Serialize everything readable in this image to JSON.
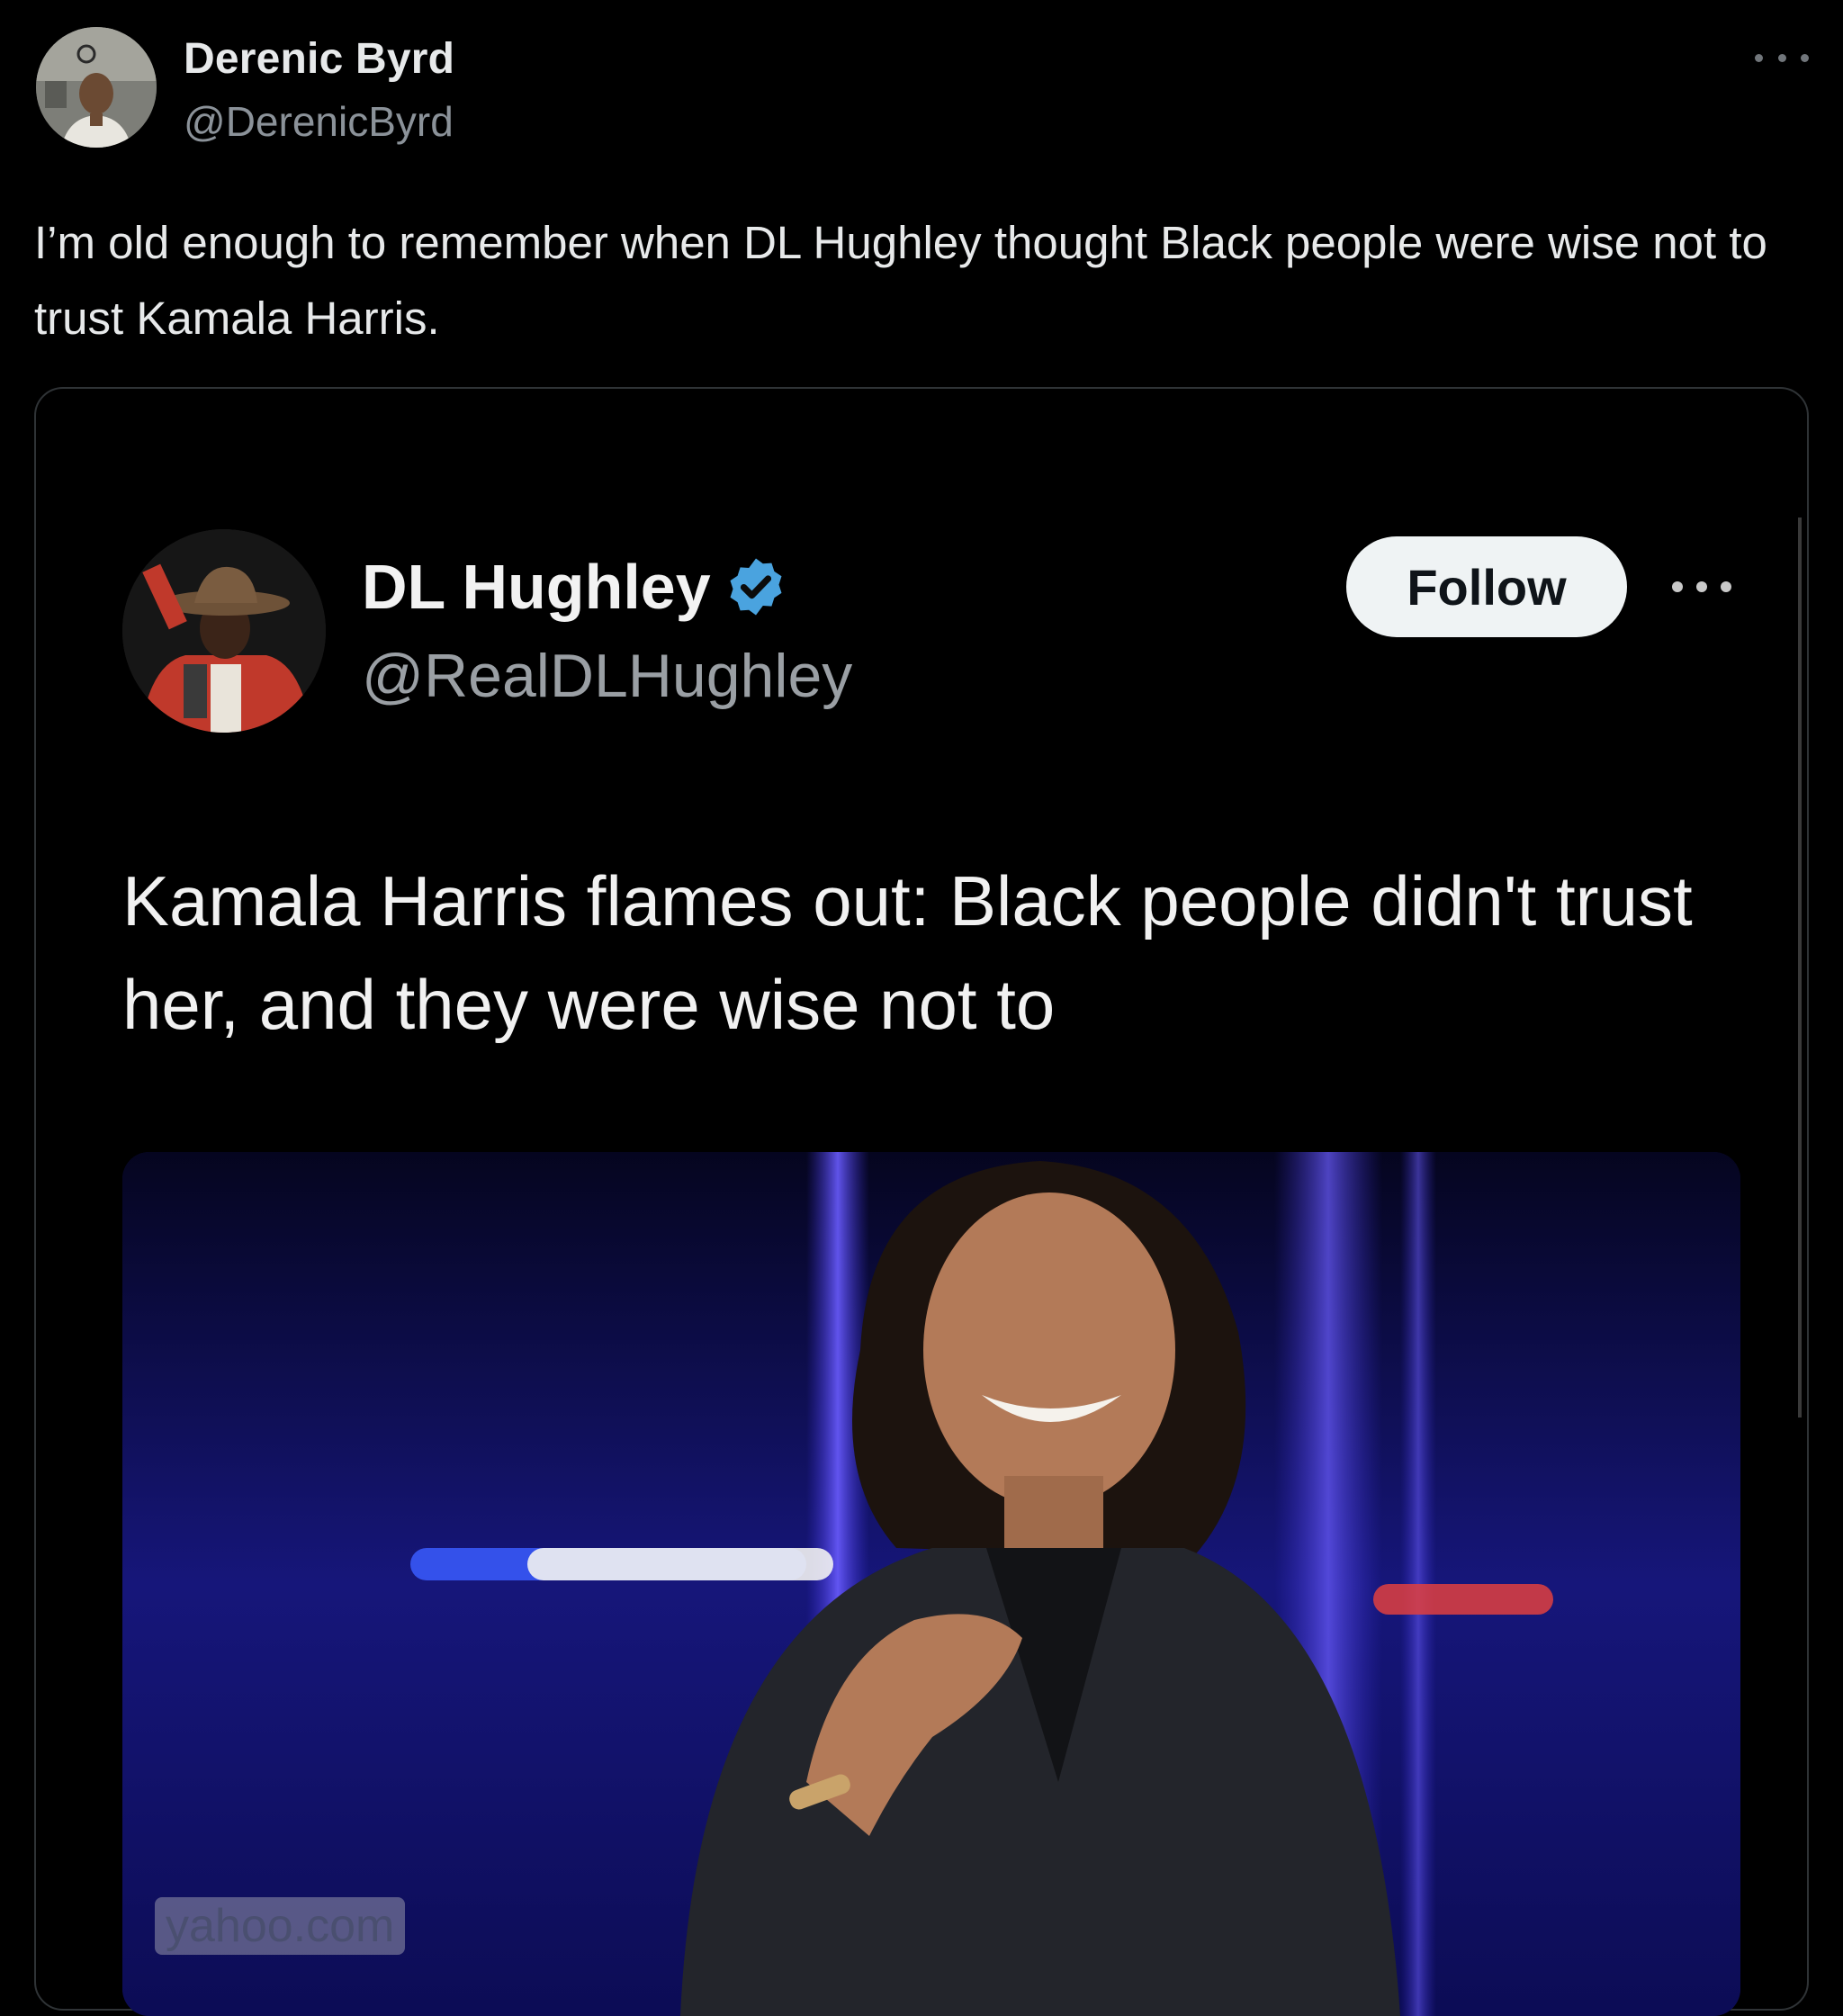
{
  "outer_tweet": {
    "author_name": "Derenic Byrd",
    "author_handle": "@DerenicByrd",
    "more_icon": "more-horizontal-icon",
    "text": "I’m old enough to remember when DL Hughley thought Black people were wise not to trust Kamala Harris."
  },
  "embedded_tweet": {
    "author_name": "DL Hughley",
    "verified_icon": "verified-badge-icon",
    "author_handle": "@RealDLHughley",
    "follow_label": "Follow",
    "more_icon": "more-horizontal-icon",
    "text": "Kamala Harris flames out: Black people didn't trust her, and they were wise not to",
    "image": {
      "watermark": "yahoo.com"
    }
  },
  "colors": {
    "background": "#000000",
    "verified_blue": "#4aa3df",
    "follow_bg": "#eff3f4",
    "secondary_text": "#8b9299"
  }
}
